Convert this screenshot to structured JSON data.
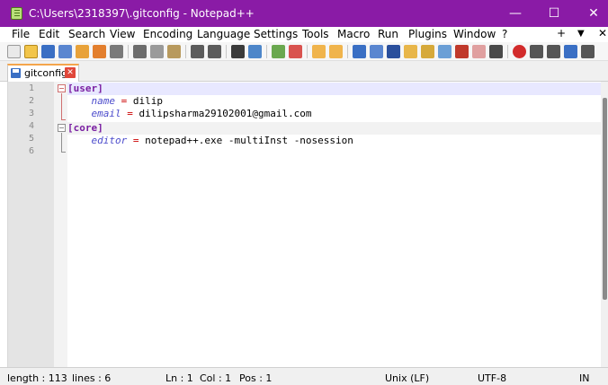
{
  "window": {
    "title": "C:\\Users\\2318397\\.gitconfig - Notepad++"
  },
  "window_controls": {
    "minimize": "—",
    "maximize": "☐",
    "close": "✕"
  },
  "menu": {
    "items": [
      "File",
      "Edit",
      "Search",
      "View",
      "Encoding",
      "Language",
      "Settings",
      "Tools",
      "Macro",
      "Run",
      "Plugins",
      "Window",
      "?"
    ],
    "right": {
      "plus": "+",
      "dropdown": "▼",
      "close": "✕"
    }
  },
  "tab": {
    "label": "gitconfig",
    "close": "✕"
  },
  "editor": {
    "line_numbers": [
      "1",
      "2",
      "3",
      "4",
      "5",
      "6"
    ],
    "lines": [
      {
        "section": "[user]"
      },
      {
        "indent": "    ",
        "key": "name",
        "eq": " = ",
        "value": "dilip"
      },
      {
        "indent": "    ",
        "key": "email",
        "eq": " = ",
        "value": "dilipsharma29102001@gmail.com"
      },
      {
        "section": "[core]"
      },
      {
        "indent": "    ",
        "key": "editor",
        "eq": " = ",
        "value": "notepad++.exe -multiInst -nosession"
      },
      {
        "text": ""
      }
    ]
  },
  "status": {
    "length": "length : 113",
    "lines": "lines : 6",
    "ln": "Ln : 1",
    "col": "Col : 1",
    "pos": "Pos : 1",
    "eol": "Unix (LF)",
    "encoding": "UTF-8",
    "mode": "IN"
  },
  "colors": {
    "titlebar": "#8a1ba6",
    "section": "#7a1fa2",
    "key": "#4c4ccc",
    "operator": "#cc0000",
    "tab_accent": "#f4a54c"
  }
}
